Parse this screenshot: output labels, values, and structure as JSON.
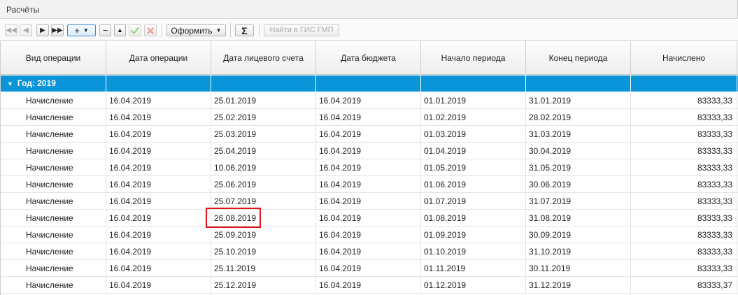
{
  "window": {
    "title": "Расчёты"
  },
  "toolbar": {
    "nav_icons": [
      "first-page-icon",
      "prev-icon",
      "next-icon",
      "last-page-icon"
    ],
    "add_label": "+",
    "remove_label": "−",
    "up_label": "▲",
    "format_label": "Оформить",
    "sum_label": "Σ",
    "gis_label": "Найти в ГИС ГМП"
  },
  "columns": [
    "Вид операции",
    "Дата операции",
    "Дата лицевого счета",
    "Дата бюджета",
    "Начало периода",
    "Конец периода",
    "Начислено"
  ],
  "group": {
    "label": "Год: 2019",
    "color": "#0a95d9"
  },
  "rows": [
    [
      "Начисление",
      "16.04.2019",
      "25.01.2019",
      "16.04.2019",
      "01.01.2019",
      "31.01.2019",
      "83333,33"
    ],
    [
      "Начисление",
      "16.04.2019",
      "25.02.2019",
      "16.04.2019",
      "01.02.2019",
      "28.02.2019",
      "83333,33"
    ],
    [
      "Начисление",
      "16.04.2019",
      "25.03.2019",
      "16.04.2019",
      "01.03.2019",
      "31.03.2019",
      "83333,33"
    ],
    [
      "Начисление",
      "16.04.2019",
      "25.04.2019",
      "16.04.2019",
      "01.04.2019",
      "30.04.2019",
      "83333,33"
    ],
    [
      "Начисление",
      "16.04.2019",
      "10.06.2019",
      "16.04.2019",
      "01.05.2019",
      "31.05.2019",
      "83333,33"
    ],
    [
      "Начисление",
      "16.04.2019",
      "25.06.2019",
      "16.04.2019",
      "01.06.2019",
      "30.06.2019",
      "83333,33"
    ],
    [
      "Начисление",
      "16.04.2019",
      "25.07.2019",
      "16.04.2019",
      "01.07.2019",
      "31.07.2019",
      "83333,33"
    ],
    [
      "Начисление",
      "16.04.2019",
      "26.08.2019",
      "16.04.2019",
      "01.08.2019",
      "31.08.2019",
      "83333,33"
    ],
    [
      "Начисление",
      "16.04.2019",
      "25.09.2019",
      "16.04.2019",
      "01.09.2019",
      "30.09.2019",
      "83333,33"
    ],
    [
      "Начисление",
      "16.04.2019",
      "25.10.2019",
      "16.04.2019",
      "01.10.2019",
      "31.10.2019",
      "83333,33"
    ],
    [
      "Начисление",
      "16.04.2019",
      "25.11.2019",
      "16.04.2019",
      "01.11.2019",
      "30.11.2019",
      "83333,33"
    ],
    [
      "Начисление",
      "16.04.2019",
      "25.12.2019",
      "16.04.2019",
      "01.12.2019",
      "31.12.2019",
      "83333,37"
    ]
  ],
  "highlight": {
    "row_index": 7,
    "column": "Дата лицевого счета",
    "color": "#e0141c"
  }
}
